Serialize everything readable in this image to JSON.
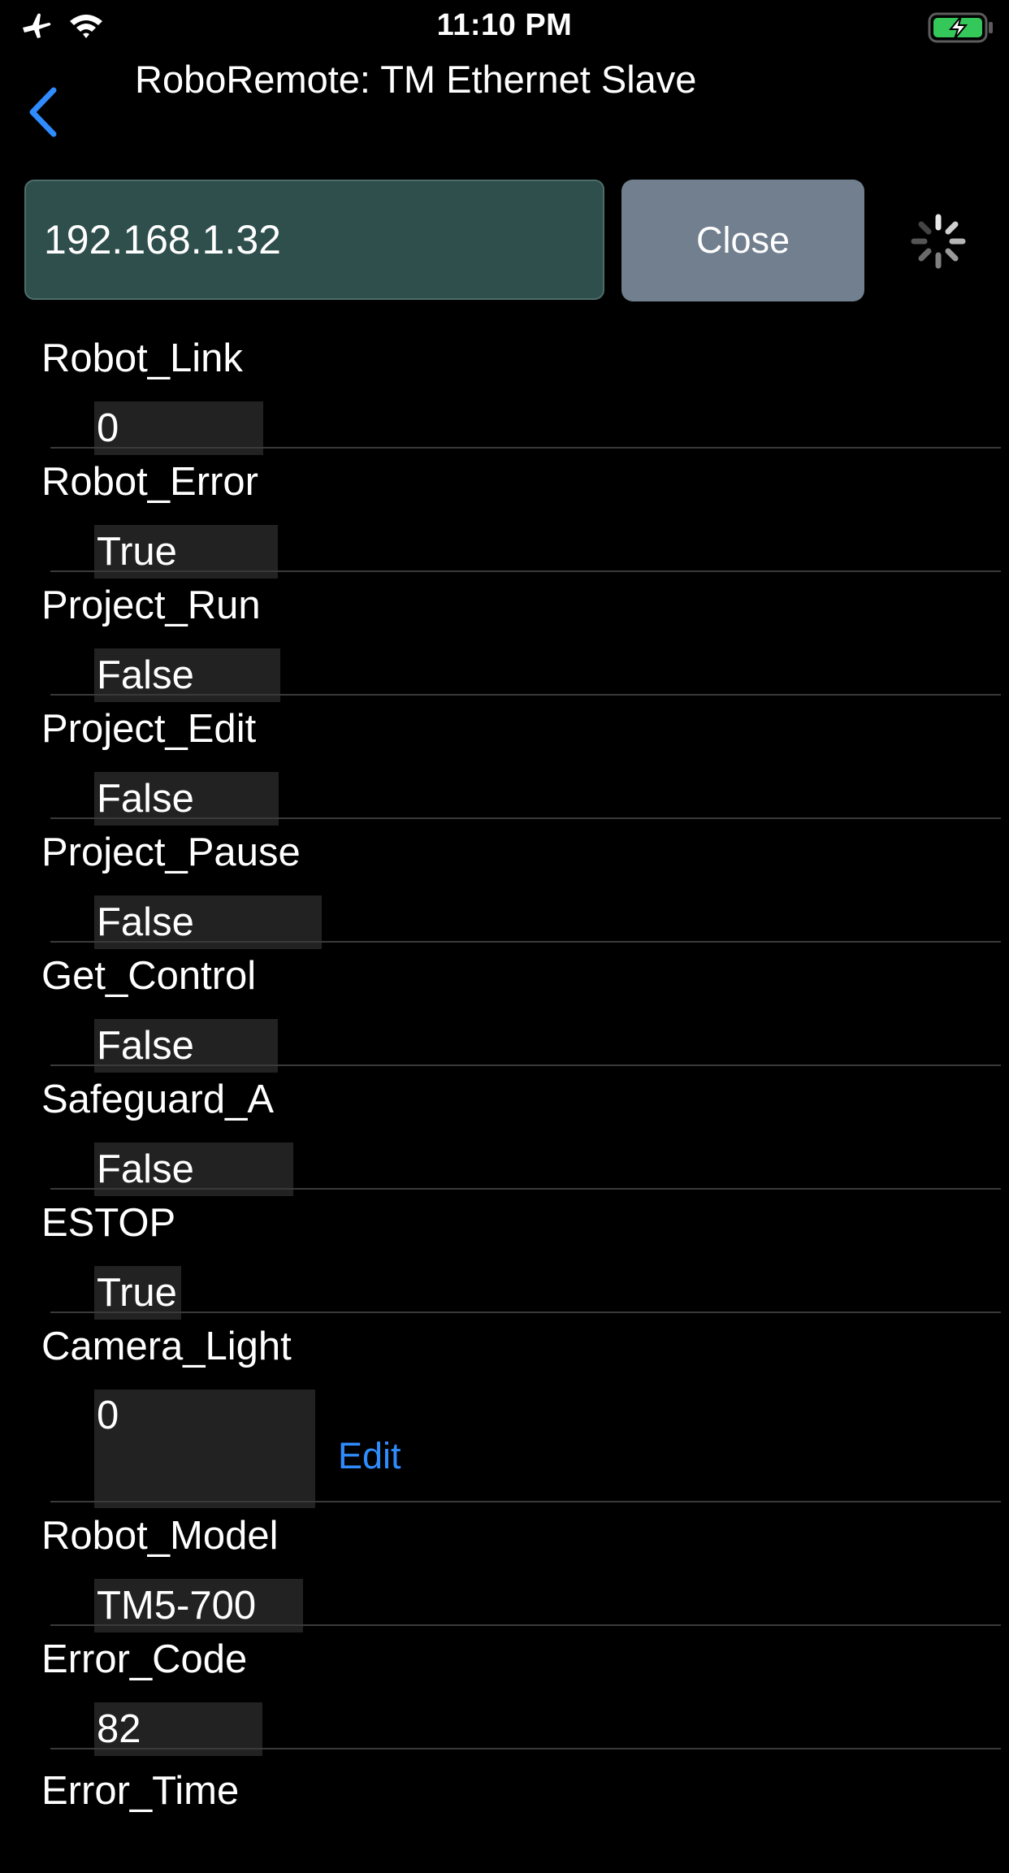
{
  "status_bar": {
    "time": "11:10 PM",
    "icons": [
      "airplane-icon",
      "wifi-icon",
      "battery-charging-icon"
    ],
    "battery_color": "#34c759"
  },
  "nav": {
    "title": "RoboRemote: TM Ethernet Slave",
    "back_icon": "chevron-left-icon",
    "accent_color": "#2f8cff"
  },
  "connection": {
    "ip_value": "192.168.1.32",
    "close_label": "Close"
  },
  "variables": [
    {
      "name": "Robot_Link",
      "value": "0"
    },
    {
      "name": "Robot_Error",
      "value": "True"
    },
    {
      "name": "Project_Run",
      "value": "False"
    },
    {
      "name": "Project_Edit",
      "value": "False"
    },
    {
      "name": "Project_Pause",
      "value": "False"
    },
    {
      "name": "Get_Control",
      "value": "False"
    },
    {
      "name": "Safeguard_A",
      "value": "False"
    },
    {
      "name": "ESTOP",
      "value": "True"
    },
    {
      "name": "Camera_Light",
      "value": "0",
      "edit_label": "Edit"
    },
    {
      "name": "Robot_Model",
      "value": "TM5-700"
    },
    {
      "name": "Error_Code",
      "value": "82"
    },
    {
      "name": "Error_Time"
    }
  ]
}
